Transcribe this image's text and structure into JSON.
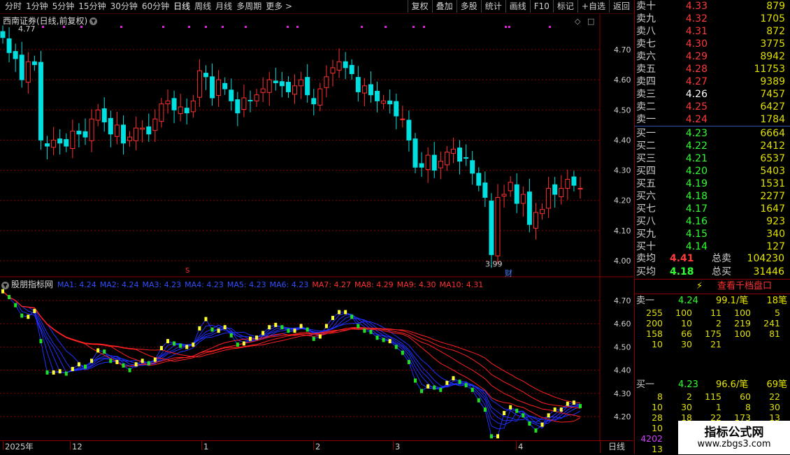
{
  "toolbar": {
    "periods": [
      "分时",
      "1分钟",
      "5分钟",
      "15分钟",
      "30分钟",
      "60分钟",
      "日线",
      "周线",
      "月线",
      "多周期",
      "更多 >"
    ],
    "active_period": "日线",
    "tools": [
      "复权",
      "叠加",
      "多股",
      "统计",
      "画线",
      "F10",
      "标记",
      "+自选",
      "返回"
    ]
  },
  "chart": {
    "title": "西南证券(日线,前复权)",
    "high_label": "4.77",
    "low_label": "3.99",
    "fin_badge": "财",
    "s_marker": "S",
    "price_ticks": [
      "4.70",
      "4.60",
      "4.50",
      "4.40",
      "4.30",
      "4.20",
      "4.10",
      "4.00"
    ],
    "ind_ticks": [
      "4.70",
      "4.60",
      "4.50",
      "4.40",
      "4.30",
      "4.20"
    ]
  },
  "indicator": {
    "name": "股朋指标网",
    "ma": [
      {
        "label": "MA1: 4.24",
        "color": "blue"
      },
      {
        "label": "MA2: 4.24",
        "color": "blue"
      },
      {
        "label": "MA3: 4.23",
        "color": "blue"
      },
      {
        "label": "MA4: 4.23",
        "color": "blue"
      },
      {
        "label": "MA5: 4.23",
        "color": "blue"
      },
      {
        "label": "MA6: 4.23",
        "color": "blue"
      },
      {
        "label": "MA7: 4.27",
        "color": "red"
      },
      {
        "label": "MA8: 4.29",
        "color": "red"
      },
      {
        "label": "MA9: 4.30",
        "color": "red"
      },
      {
        "label": "MA10: 4.31",
        "color": "red"
      }
    ]
  },
  "time_axis": {
    "labels": [
      "2025年",
      "12",
      "1",
      "2",
      "3",
      "4"
    ],
    "period_label": "日线"
  },
  "orderbook": {
    "asks": [
      {
        "label": "卖十",
        "price": "4.33",
        "vol": "879"
      },
      {
        "label": "卖九",
        "price": "4.32",
        "vol": "1705"
      },
      {
        "label": "卖八",
        "price": "4.31",
        "vol": "872"
      },
      {
        "label": "卖七",
        "price": "4.30",
        "vol": "3775"
      },
      {
        "label": "卖六",
        "price": "4.29",
        "vol": "8942"
      },
      {
        "label": "卖五",
        "price": "4.28",
        "vol": "11753"
      },
      {
        "label": "卖四",
        "price": "4.27",
        "vol": "9389"
      },
      {
        "label": "卖三",
        "price": "4.26",
        "vol": "7457"
      },
      {
        "label": "卖二",
        "price": "4.25",
        "vol": "6427"
      },
      {
        "label": "卖一",
        "price": "4.24",
        "vol": "1784"
      }
    ],
    "bids": [
      {
        "label": "买一",
        "price": "4.23",
        "vol": "6664"
      },
      {
        "label": "买二",
        "price": "4.22",
        "vol": "2412"
      },
      {
        "label": "买三",
        "price": "4.21",
        "vol": "6537"
      },
      {
        "label": "买四",
        "price": "4.20",
        "vol": "5403"
      },
      {
        "label": "买五",
        "price": "4.19",
        "vol": "1531"
      },
      {
        "label": "买六",
        "price": "4.18",
        "vol": "2277"
      },
      {
        "label": "买七",
        "price": "4.17",
        "vol": "1647"
      },
      {
        "label": "买八",
        "price": "4.16",
        "vol": "923"
      },
      {
        "label": "买九",
        "price": "4.15",
        "vol": "340"
      },
      {
        "label": "买十",
        "price": "4.14",
        "vol": "127"
      }
    ],
    "summary": [
      {
        "label": "卖均",
        "price": "4.41",
        "tlabel": "总卖",
        "total": "104230"
      },
      {
        "label": "买均",
        "price": "4.18",
        "tlabel": "总买",
        "total": "31446"
      }
    ],
    "button": "查看千档盘口",
    "ask_queue": {
      "label": "卖一",
      "price": "4.24",
      "avg": "99.1/笔",
      "count": "18笔",
      "rows": [
        [
          "255",
          "100",
          "11",
          "100",
          "5"
        ],
        [
          "200",
          "10",
          "2",
          "219",
          "241"
        ],
        [
          "158",
          "66",
          "175",
          "100",
          "81"
        ],
        [
          "10",
          "30",
          "21",
          "",
          ""
        ]
      ]
    },
    "bid_queue": {
      "label": "买一",
      "price": "4.23",
      "avg": "96.6/笔",
      "count": "69笔",
      "rows": [
        [
          "8",
          "2",
          "115",
          "60",
          "22"
        ],
        [
          "10",
          "30",
          "1",
          "8",
          "30"
        ],
        [
          "28",
          "18",
          "22",
          "173",
          "13"
        ],
        [
          "10",
          "",
          "",
          "",
          ""
        ]
      ],
      "extra": [
        "4202",
        "13"
      ]
    }
  },
  "watermark": {
    "line1": "指标公式网",
    "line2": "www.zbgs3.com"
  },
  "colors": {
    "up": "#ff3030",
    "down": "#00e0e0",
    "grid": "#8a0000",
    "ma_blue": "#2030ff",
    "ma_red": "#ff2020"
  }
}
